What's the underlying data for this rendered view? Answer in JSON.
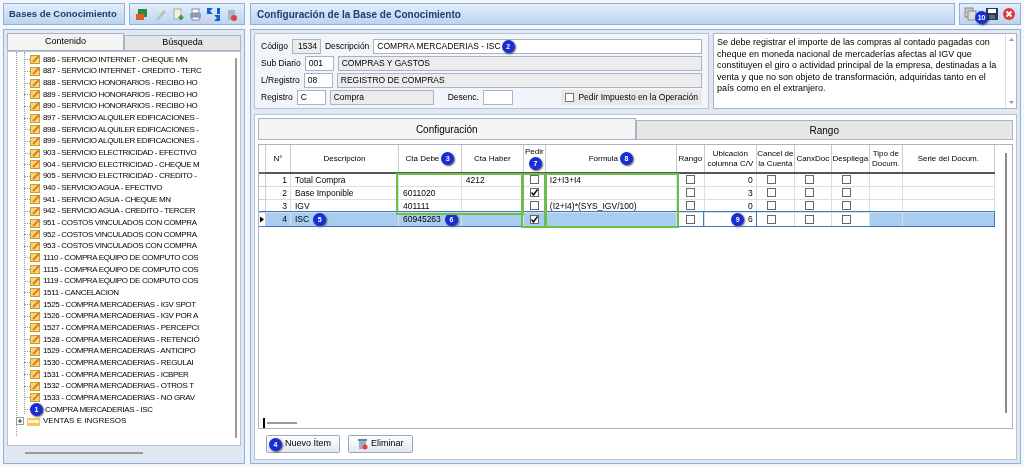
{
  "left_panel": {
    "title": "Bases de Conocimiento",
    "tabs": [
      {
        "label": "Contenido",
        "selected": true
      },
      {
        "label": "Búsqueda",
        "selected": false
      }
    ],
    "tree_items": [
      {
        "label": "886 - SERVICIO INTERNET - CHEQUE MN"
      },
      {
        "label": "887 - SERVICIO INTERNET - CREDITO - TERC"
      },
      {
        "label": "888 - SERVICIO HONORARIOS - RECIBO HO"
      },
      {
        "label": "889 - SERVICIO HONORARIOS - RECIBO HO"
      },
      {
        "label": "890 - SERVICIO HONORARIOS - RECIBO HO"
      },
      {
        "label": "897 - SERVICIO ALQUILER EDIFICACIONES -"
      },
      {
        "label": "898 - SERVICIO ALQUILER EDIFICACIONES -"
      },
      {
        "label": "899 - SERVICIO ALQUILER EDIFICACIONES -"
      },
      {
        "label": "903 - SERVICIO ELECTRICIDAD - EFECTIVO"
      },
      {
        "label": "904 - SERVICIO ELECTRICIDAD - CHEQUE M"
      },
      {
        "label": "905 - SERVICIO ELECTRICIDAD - CREDITO -"
      },
      {
        "label": "940 - SERVICIO AGUA - EFECTIVO"
      },
      {
        "label": "941 - SERVICIO AGUA - CHEQUE MN"
      },
      {
        "label": "942 - SERVICIO AGUA - CREDITO - TERCER"
      },
      {
        "label": "951 - COSTOS VINCULADOS CON COMPRA"
      },
      {
        "label": "952 - COSTOS VINCULADOS CON COMPRA"
      },
      {
        "label": "953 - COSTOS VINCULADOS CON COMPRA"
      },
      {
        "label": "1110 - COMPRA EQUIPO DE COMPUTO COS"
      },
      {
        "label": "1115 - COMPRA EQUIPO DE COMPUTO COS"
      },
      {
        "label": "1119 - COMPRA EQUIPO DE COMPUTO COS"
      },
      {
        "label": "1511 - CANCELACION"
      },
      {
        "label": "1525 - COMPRA MERCADERIAS - IGV SPOT"
      },
      {
        "label": "1526 - COMPRA MERCADERIAS - IGV POR A"
      },
      {
        "label": "1527 - COMPRA MERCADERIAS - PERCEPCI"
      },
      {
        "label": "1528 - COMPRA MERCADERIAS - RETENCIÓ"
      },
      {
        "label": "1529 - COMPRA MERCADERIAS - ANTICIPO"
      },
      {
        "label": "1530 - COMPRA MERCADERIAS -  REGULAI"
      },
      {
        "label": "1531 - COMPRA MERCADERIAS - ICBPER"
      },
      {
        "label": "1532 - COMPRA MERCADERIAS - OTROS T"
      },
      {
        "label": "1533 - COMPRA MERCADERIAS - NO GRAV"
      },
      {
        "label": "COMPRA MERCADERIAS - ISC",
        "marker": "1"
      }
    ],
    "folders": [
      {
        "label": "VENTAS E INGRESOS",
        "expanded": false
      }
    ]
  },
  "right_panel": {
    "title": "Configuración de la Base de Conocimiento",
    "save_marker": "10",
    "form": {
      "codigo_label": "Código",
      "codigo": "1534",
      "descripcion_label": "Descripción",
      "descripcion": "COMPRA MERCADERIAS - ISC",
      "descripcion_marker": "2",
      "sub_diario_label": "Sub Diario",
      "sub_diario": "001",
      "sub_diario_name": "COMPRAS Y GASTOS",
      "registro_libro_label": "L/Registro",
      "registro_libro": "08",
      "registro_libro_name": "REGISTRO DE COMPRAS",
      "registro_label": "Registro",
      "registro": "C",
      "registro_name": "Compra",
      "desenc_label": "Desenc.",
      "pedir_impuesto_label": "Pedir Impuesto en la Operación",
      "pedir_impuesto": false
    },
    "note": "Se debe registrar el importe de las compras al contado pagadas con cheque en moneda nacional de mercaderías afectas al IGV que constituyen el giro o actividad principal de la empresa, destinadas a la venta y que no son objeto de transformación, adquiridas tanto en el país como en el extranjero.",
    "tabs": [
      {
        "label": "Configuración",
        "selected": true
      },
      {
        "label": "Rango",
        "selected": false
      }
    ],
    "table": {
      "columns": [
        {
          "label": "N°"
        },
        {
          "label": "Descripción"
        },
        {
          "label": "Cta Debe",
          "marker": "3"
        },
        {
          "label": "Cta Haber"
        },
        {
          "label": "Pedir",
          "marker": "7"
        },
        {
          "label": "Formula",
          "marker": "8"
        },
        {
          "label": "Rango"
        },
        {
          "label": "Ubicación columna C/V"
        },
        {
          "label": "Cancel de la Cuenta"
        },
        {
          "label": "CanxDoc"
        },
        {
          "label": "Despliega"
        },
        {
          "label": "Tipo de Docum."
        },
        {
          "label": "Serie del Docum."
        }
      ],
      "rows": [
        {
          "n": "1",
          "descripcion": "Total Compra",
          "cta_debe": "",
          "cta_haber": "4212",
          "pedir": false,
          "formula": "I2+I3+I4",
          "rango": false,
          "ubicacion": "0",
          "cancel": false,
          "canxdoc": false,
          "despliega": false,
          "selected": false
        },
        {
          "n": "2",
          "descripcion": "Base Imponible",
          "cta_debe": "6011020",
          "cta_haber": "",
          "pedir": true,
          "formula": "",
          "rango": false,
          "ubicacion": "3",
          "cancel": false,
          "canxdoc": false,
          "despliega": false,
          "selected": false
        },
        {
          "n": "3",
          "descripcion": "IGV",
          "cta_debe": "401111",
          "cta_haber": "",
          "pedir": false,
          "formula": "(I2+I4)*(SYS_IGV/100)",
          "rango": false,
          "ubicacion": "0",
          "cancel": false,
          "canxdoc": false,
          "despliega": false,
          "selected": false
        },
        {
          "n": "4",
          "descripcion": "ISC",
          "descripcion_marker": "5",
          "cta_debe": "60945263",
          "cta_debe_marker": "6",
          "cta_haber": "",
          "pedir": true,
          "formula": "",
          "rango": false,
          "ubicacion": "6",
          "ubicacion_marker": "9",
          "cancel": false,
          "canxdoc": false,
          "despliega": false,
          "selected": true
        }
      ]
    },
    "buttons": [
      {
        "kind": "add",
        "label": "Nuevo Ítem",
        "marker": "4"
      },
      {
        "kind": "delete",
        "label": "Eliminar"
      }
    ]
  }
}
